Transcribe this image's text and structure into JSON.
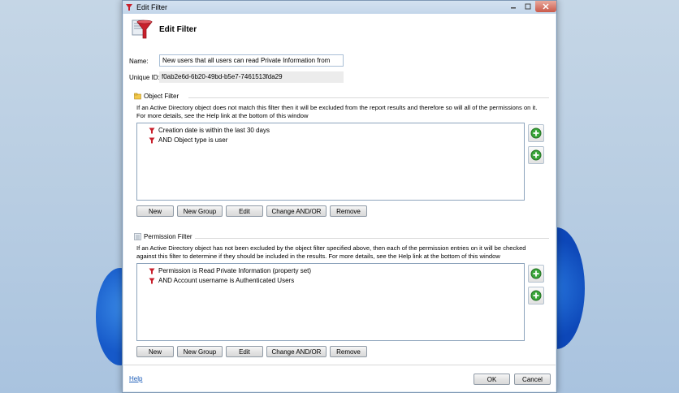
{
  "window": {
    "title": "Edit Filter"
  },
  "header": {
    "title": "Edit Filter"
  },
  "form": {
    "name_label": "Name:",
    "name_value": "New users that all users can read Private Information from",
    "unique_id_label": "Unique ID:",
    "unique_id_value": "f0ab2e6d-6b20-49bd-b5e7-7461513fda29"
  },
  "object_filter": {
    "title": "Object Filter",
    "description": "If an Active Directory object does not match this filter then it will be excluded from the report results and therefore so will all of the permissions on it. For more details, see the Help link at the bottom of this window",
    "items": [
      "Creation date is within the last 30 days",
      "AND Object type is user"
    ],
    "buttons": {
      "new": "New",
      "new_group": "New Group",
      "edit": "Edit",
      "change_and_or": "Change AND/OR",
      "remove": "Remove"
    }
  },
  "permission_filter": {
    "title": "Permission Filter",
    "description": "If an Active Directory object has not been excluded by the object filter specified above, then each of the permission entries on it will be checked against this filter to determine if they should be included in the results. For more details, see the Help link at the bottom of this window",
    "items": [
      "Permission is Read Private Information  (property set)",
      "AND Account username is Authenticated Users"
    ],
    "buttons": {
      "new": "New",
      "new_group": "New Group",
      "edit": "Edit",
      "change_and_or": "Change AND/OR",
      "remove": "Remove"
    }
  },
  "footer": {
    "help": "Help",
    "ok": "OK",
    "cancel": "Cancel"
  },
  "colors": {
    "accent_link": "#1b5cb8",
    "add_button_green": "#3aa63a",
    "filter_icon_red": "#c8202c"
  }
}
